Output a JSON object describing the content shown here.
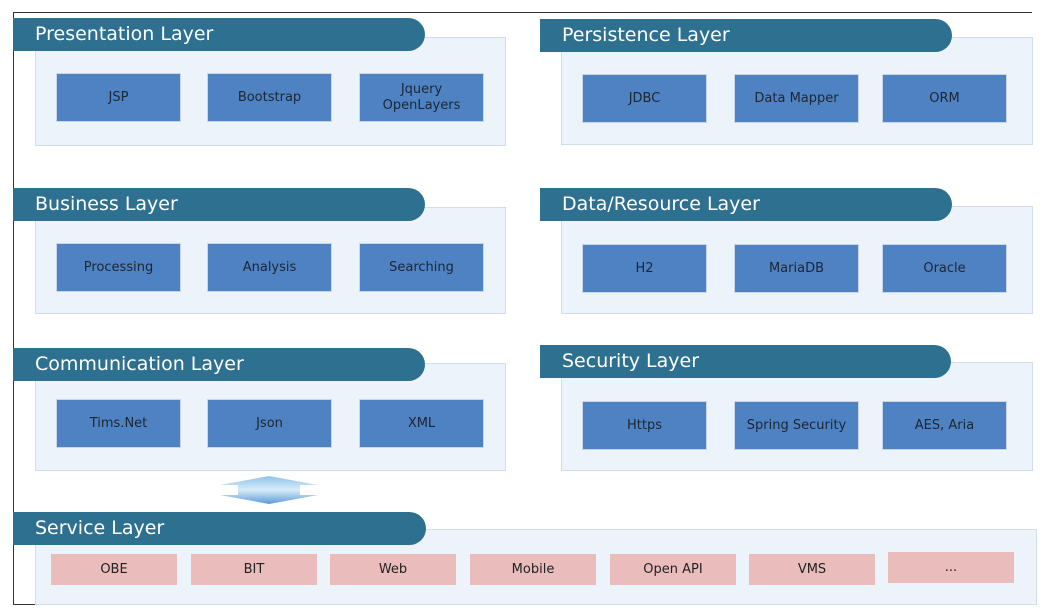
{
  "layers": {
    "presentation": {
      "title": "Presentation Layer",
      "items": [
        "JSP",
        "Bootstrap",
        "Jquery\nOpenLayers"
      ]
    },
    "business": {
      "title": "Business Layer",
      "items": [
        "Processing",
        "Analysis",
        "Searching"
      ]
    },
    "communication": {
      "title": "Communication Layer",
      "items": [
        "Tims.Net",
        "Json",
        "XML"
      ]
    },
    "persistence": {
      "title": "Persistence Layer",
      "items": [
        "JDBC",
        "Data  Mapper",
        "ORM"
      ]
    },
    "data_resource": {
      "title": "Data/Resource Layer",
      "items": [
        "H2",
        "MariaDB",
        "Oracle"
      ]
    },
    "security": {
      "title": "Security Layer",
      "items": [
        "Https",
        "Spring Security",
        "AES, Aria"
      ]
    },
    "service": {
      "title": "Service Layer",
      "items": [
        "OBE",
        "BIT",
        "Web",
        "Mobile",
        "Open API",
        "VMS",
        "..."
      ]
    }
  },
  "colors": {
    "header": "#2e7090",
    "component": "#4f82c3",
    "service_component": "#ebbcbc",
    "panel": "#edf3fb"
  }
}
